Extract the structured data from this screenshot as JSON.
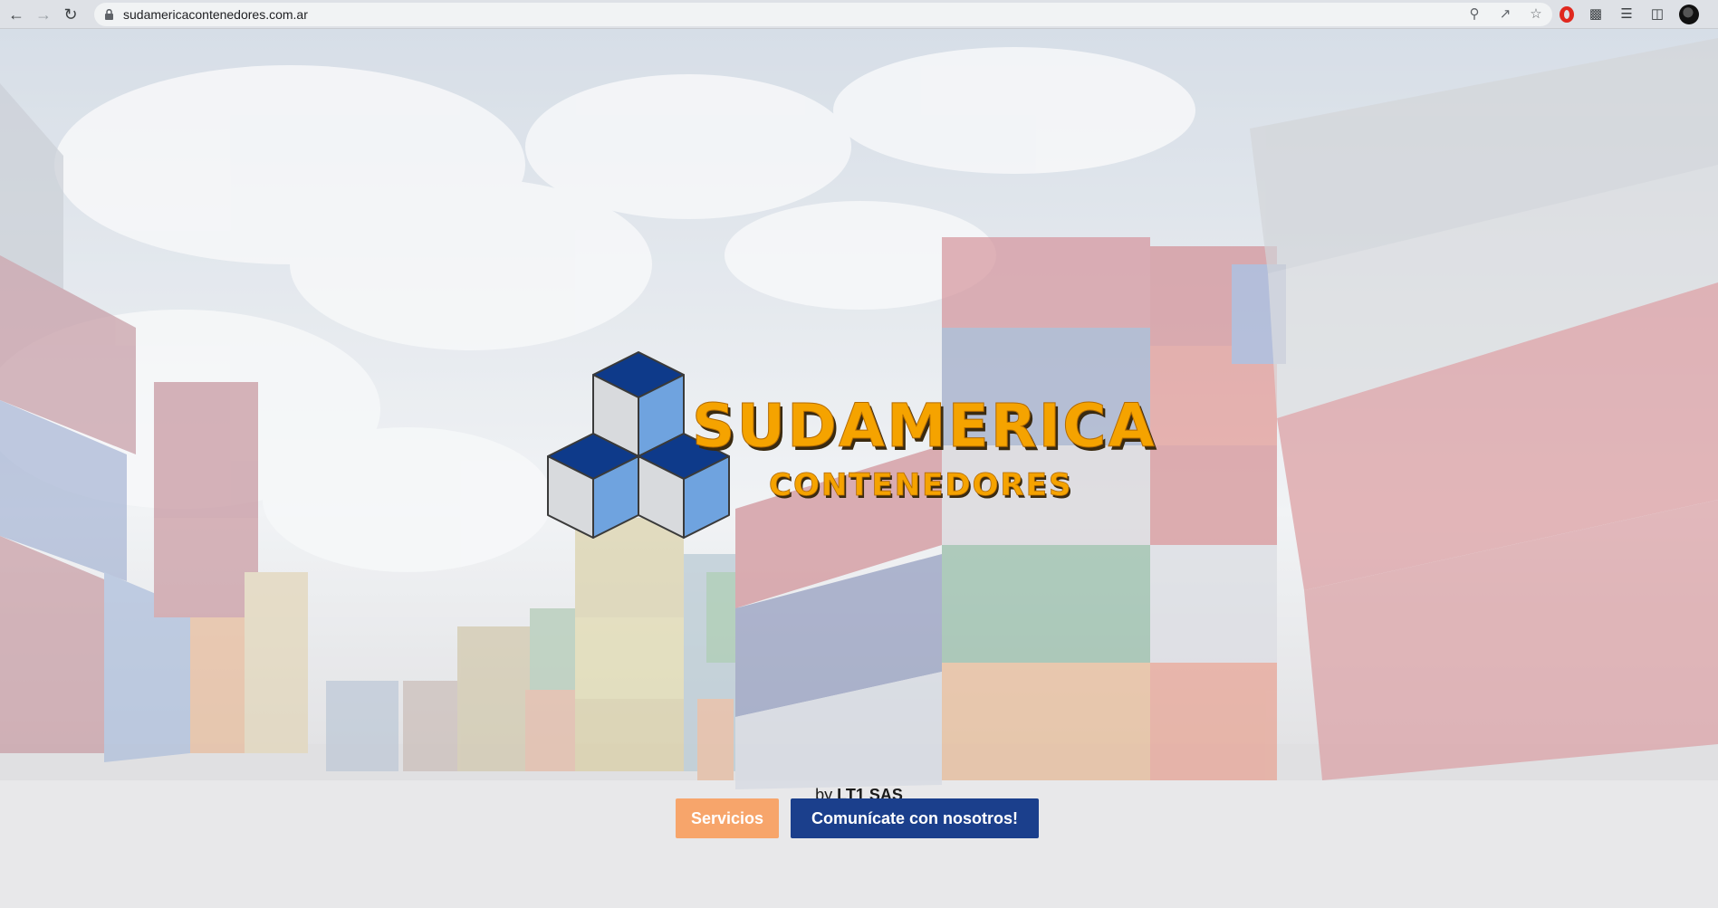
{
  "browser": {
    "url": "sudamericacontenedores.com.ar",
    "icons": {
      "back": "back-arrow-icon",
      "forward": "forward-arrow-icon",
      "reload": "reload-icon",
      "lock": "lock-icon",
      "zoom": "zoom-icon",
      "share": "share-icon",
      "bookmark": "star-icon",
      "opera": "opera-icon",
      "extensions": "puzzle-icon",
      "reading_list": "reading-list-icon",
      "side_panel": "side-panel-icon",
      "profile": "avatar-icon"
    }
  },
  "logo": {
    "line1": "SUDAMERICA",
    "line2": "CONTENEDORES",
    "colors": {
      "orange": "#f5a300",
      "navy": "#0e3a8a",
      "light_blue": "#6fa3df",
      "grey": "#d8dadd"
    }
  },
  "byline": {
    "prefix": "by",
    "company": "LT1 SAS"
  },
  "buttons": {
    "servicios": "Servicios",
    "contact": "Comunícate con nosotros!"
  },
  "colors": {
    "servicios_bg": "#f7a56b",
    "contact_bg": "#1b3f8c"
  }
}
